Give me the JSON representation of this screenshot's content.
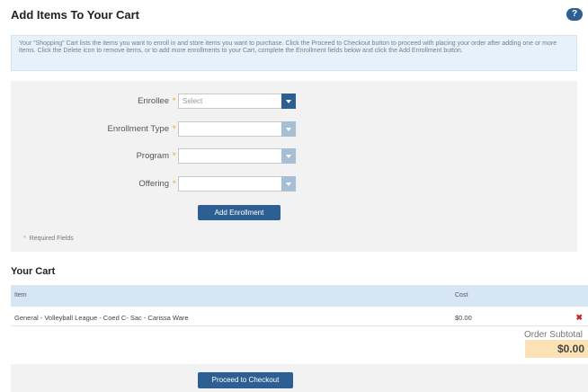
{
  "page": {
    "title": "Add Items To Your Cart",
    "help_icon": "?",
    "info_text": "Your \"Shopping\" Cart lists the items you want to enroll in and store items you want to purchase. Click the Proceed to Checkout button to proceed with placing your order after adding one or more items. Click the Delete icon to remove items, or to add more enrollments to your Cart, complete the Enrollment fields below and click the Add Enrollment button."
  },
  "form": {
    "required_marker": "*",
    "fields": [
      {
        "label": "Enrollee",
        "value": "Select"
      },
      {
        "label": "Enrollment Type",
        "value": ""
      },
      {
        "label": "Program",
        "value": ""
      },
      {
        "label": "Offering",
        "value": ""
      }
    ],
    "add_button": "Add Enrollment",
    "required_note": "Required Fields"
  },
  "cart": {
    "title": "Your Cart",
    "columns": {
      "item": "Item",
      "cost": "Cost"
    },
    "rows": [
      {
        "item": "General - Volleyball League - Coed C- Sac - Carissa Ware",
        "cost": "$0.00",
        "delete_glyph": "✖"
      }
    ],
    "subtotal_label": "Order Subtotal",
    "subtotal_value": "$0.00",
    "checkout_button": "Proceed to Checkout"
  },
  "colors": {
    "primary_button": "#2d5f93",
    "info_bg": "#e6f1f9",
    "table_header_bg": "#d6e6f2",
    "subtotal_bg": "#fbe2b6",
    "delete_red": "#cc2222",
    "required_star": "#e89a2c"
  },
  "icons": {
    "help": "help-icon",
    "delete": "delete-icon",
    "dropdown": "chevron-down-icon"
  }
}
